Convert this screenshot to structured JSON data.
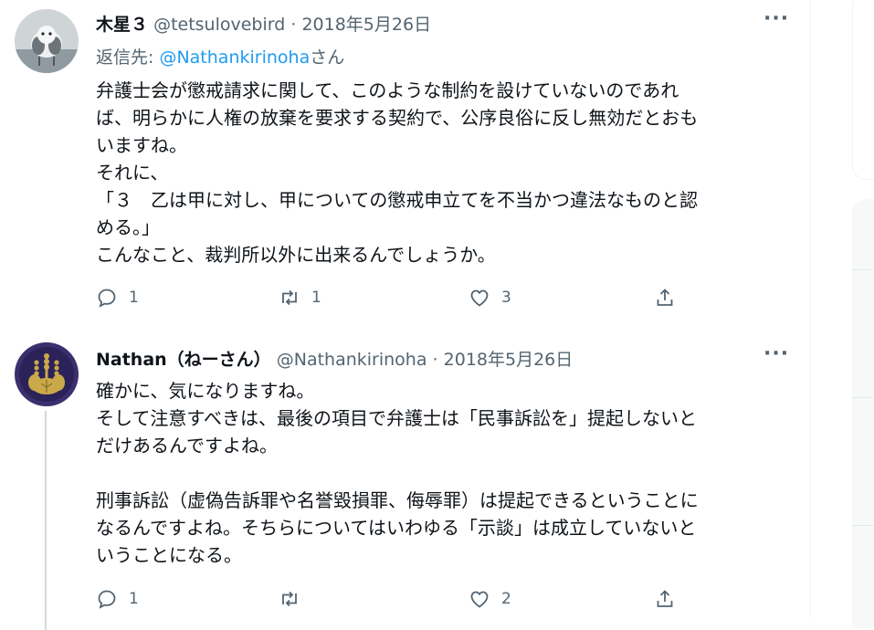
{
  "tweets": [
    {
      "name": "木星３",
      "handle": "@tetsulovebird",
      "separator": "·",
      "date": "2018年5月26日",
      "reply_prefix": "返信先: ",
      "reply_mention": "@Nathankirinoha",
      "reply_suffix": "さん",
      "text": "弁護士会が懲戒請求に関して、このような制約を設けていないのであれ\nば、明らかに人権の放棄を要求する契約で、公序良俗に反し無効だとおも\nいますね。\nそれに、\n「３　乙は甲に対し、甲についての懲戒申立てを不当かつ違法なものと認\nめる。」\nこんなこと、裁判所以外に出来るんでしょうか。",
      "reply_count": "1",
      "retweet_count": "1",
      "like_count": "3",
      "more": "···"
    },
    {
      "name": "Nathan（ねーさん）",
      "handle": "@Nathankirinoha",
      "separator": "·",
      "date": "2018年5月26日",
      "text": "確かに、気になりますね。\nそして注意すべきは、最後の項目で弁護士は「民事訴訟を」提起しないと\nだけあるんですよね。\n\n刑事訴訟（虚偽告訴罪や名誉毀損罪、侮辱罪）は提起できるということに\nなるんですよね。そちらについてはいわゆる「示談」は成立していないと\nいうことになる。",
      "reply_count": "1",
      "retweet_count": "",
      "like_count": "2",
      "more": "···"
    }
  ],
  "icons": [
    "reply-icon",
    "retweet-icon",
    "like-icon",
    "share-icon",
    "more-icon"
  ],
  "colors": {
    "text": "#0f1419",
    "secondary": "#536471",
    "link": "#1d9bf0",
    "border": "#cfd9de"
  }
}
